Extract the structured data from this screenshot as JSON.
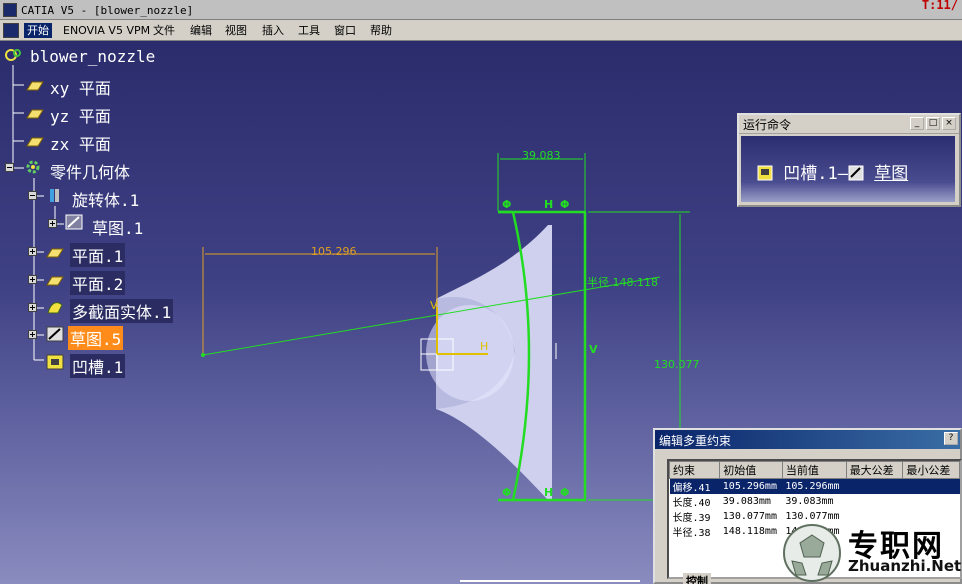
{
  "window": {
    "title": "CATIA V5 - [blower_nozzle]",
    "status_text": "T:11/"
  },
  "menu": {
    "items": [
      "开始",
      "ENOVIA V5 VPM",
      "文件",
      "编辑",
      "视图",
      "插入",
      "工具",
      "窗口",
      "帮助"
    ]
  },
  "tree": {
    "root": "blower_nozzle",
    "nodes": [
      {
        "label": "xy 平面",
        "icon": "plane-icon"
      },
      {
        "label": "yz 平面",
        "icon": "plane-icon"
      },
      {
        "label": "zx 平面",
        "icon": "plane-icon"
      },
      {
        "label": "零件几何体",
        "icon": "gear-icon"
      },
      {
        "label": "旋转体.1",
        "icon": "revolve-icon"
      },
      {
        "label": "草图.1",
        "icon": "sketch-icon"
      },
      {
        "label": "平面.1",
        "icon": "plane-icon"
      },
      {
        "label": "平面.2",
        "icon": "plane-icon"
      },
      {
        "label": "多截面实体.1",
        "icon": "multisection-icon"
      },
      {
        "label": "草图.5",
        "icon": "sketch-icon",
        "selected": true
      },
      {
        "label": "凹槽.1",
        "icon": "pocket-icon"
      }
    ]
  },
  "sketch": {
    "dim_top": "39.083",
    "dim_left": "105.296",
    "dim_radius": "半径 148.118",
    "dim_right": "130.077",
    "axis_h": "H",
    "axis_v": "V",
    "constraint_phi": "Φ",
    "constraint_h": "H",
    "constraint_v": "V"
  },
  "run_command": {
    "title": "运行命令",
    "cmd_a": "凹槽.1",
    "cmd_sep": "—",
    "cmd_b": "草图",
    "btn_min": "_",
    "btn_max": "□",
    "btn_close": "×"
  },
  "dialog": {
    "title": "编辑多重约束",
    "help": "?",
    "columns": [
      "约束",
      "初始值",
      "当前值",
      "最大公差",
      "最小公差"
    ],
    "rows": [
      [
        "偏移.41",
        "105.296mm",
        "105.296mm",
        "",
        ""
      ],
      [
        "长度.40",
        "39.083mm",
        "39.083mm",
        "",
        ""
      ],
      [
        "长度.39",
        "130.077mm",
        "130.077mm",
        "",
        ""
      ],
      [
        "半径.38",
        "148.118mm",
        "148.118mm",
        "",
        ""
      ]
    ],
    "group_label": "控制"
  },
  "watermark": {
    "title": "专职网",
    "url": "Zhuanzhi.Net"
  },
  "colors": {
    "sketch_green": "#22dd22",
    "dim_orange": "#e0a020",
    "selection_orange": "#ff8c1a",
    "title_blue": "#0a246a"
  }
}
